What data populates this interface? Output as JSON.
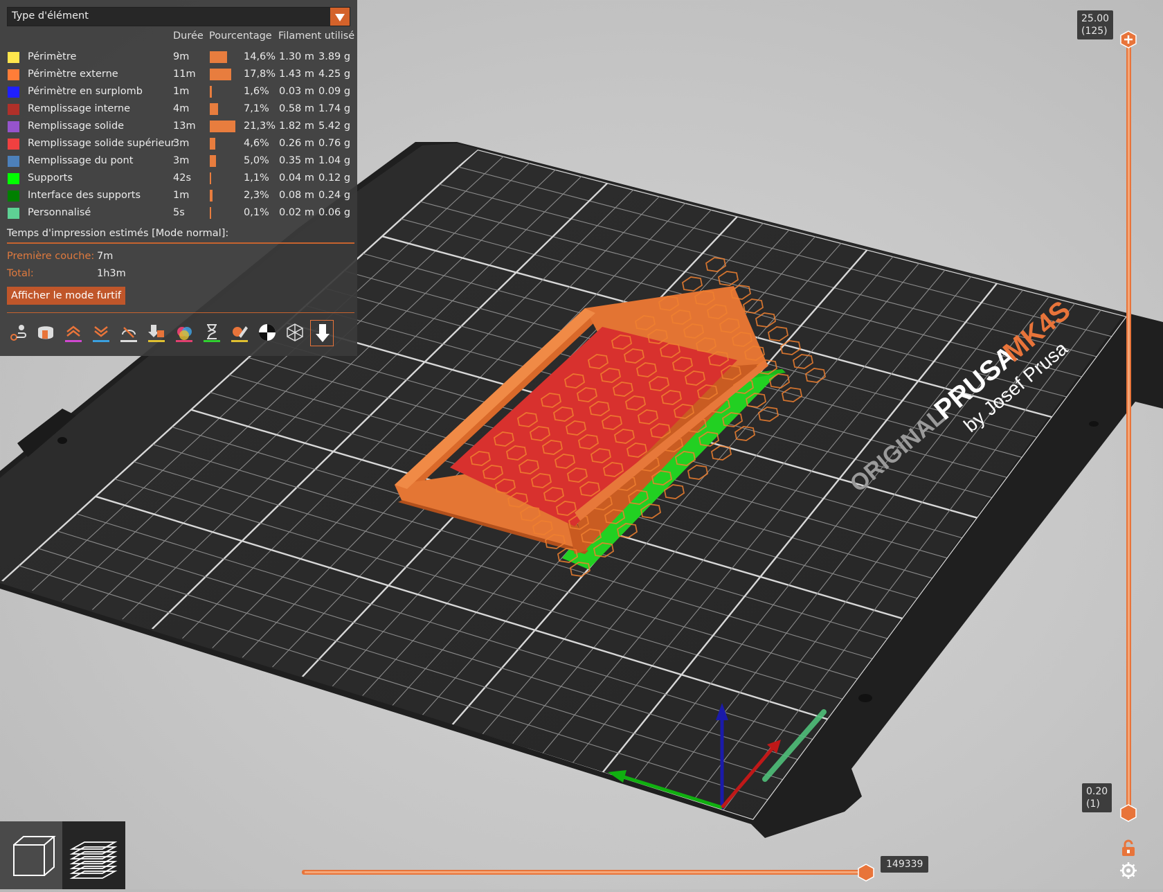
{
  "legend": {
    "dropdown_label": "Type d'élément",
    "columns": {
      "duration": "Durée",
      "percentage": "Pourcentage",
      "filament": "Filament utilisé"
    },
    "rows": [
      {
        "name": "Périmètre",
        "color": "#FFE64D",
        "time": "9m",
        "percent": "14,6%",
        "percent_value": 14.6,
        "length": "1.30 m",
        "weight": "3.89 g"
      },
      {
        "name": "Périmètre externe",
        "color": "#FF7D38",
        "time": "11m",
        "percent": "17,8%",
        "percent_value": 17.8,
        "length": "1.43 m",
        "weight": "4.25 g"
      },
      {
        "name": "Périmètre en surplomb",
        "color": "#1F1FFF",
        "time": "1m",
        "percent": "1,6%",
        "percent_value": 1.6,
        "length": "0.03 m",
        "weight": "0.09 g"
      },
      {
        "name": "Remplissage interne",
        "color": "#B03029",
        "time": "4m",
        "percent": "7,1%",
        "percent_value": 7.1,
        "length": "0.58 m",
        "weight": "1.74 g"
      },
      {
        "name": "Remplissage solide",
        "color": "#9654CC",
        "time": "13m",
        "percent": "21,3%",
        "percent_value": 21.3,
        "length": "1.82 m",
        "weight": "5.42 g"
      },
      {
        "name": "Remplissage solide supérieur",
        "color": "#F04040",
        "time": "3m",
        "percent": "4,6%",
        "percent_value": 4.6,
        "length": "0.26 m",
        "weight": "0.76 g"
      },
      {
        "name": "Remplissage du pont",
        "color": "#4D80BA",
        "time": "3m",
        "percent": "5,0%",
        "percent_value": 5.0,
        "length": "0.35 m",
        "weight": "1.04 g"
      },
      {
        "name": "Supports",
        "color": "#00FF00",
        "time": "42s",
        "percent": "1,1%",
        "percent_value": 1.1,
        "length": "0.04 m",
        "weight": "0.12 g"
      },
      {
        "name": "Interface des supports",
        "color": "#008000",
        "time": "1m",
        "percent": "2,3%",
        "percent_value": 2.3,
        "length": "0.08 m",
        "weight": "0.24 g"
      },
      {
        "name": "Personnalisé",
        "color": "#5ED194",
        "time": "5s",
        "percent": "0,1%",
        "percent_value": 0.1,
        "length": "0.02 m",
        "weight": "0.06 g"
      }
    ],
    "estimate_title": "Temps d'impression estimés [Mode normal]:",
    "first_layer_label": "Première couche:",
    "first_layer_value": "7m",
    "total_label": "Total:",
    "total_value": "1h3m",
    "stealth_button": "Afficher le mode furtif",
    "toolbar_icons": [
      "travel-icon",
      "wipe-icon",
      "retractions-icon",
      "deretractions-icon",
      "seams-icon",
      "tool-changes-icon",
      "color-changes-icon",
      "pause-icon",
      "custom-gcode-icon",
      "center-of-gravity-icon",
      "shells-icon",
      "tool-marker-icon"
    ]
  },
  "layer_slider": {
    "top_height": "25.00",
    "top_layer": "(125)",
    "bottom_height": "0.20",
    "bottom_layer": "(1)"
  },
  "move_slider": {
    "value": "149339"
  },
  "bed": {
    "brand_original": "ORIGINAL",
    "brand_prusa": "PRUSA",
    "brand_model": "MK4S",
    "brand_by": "by Josef Prusa"
  },
  "view_switch": {
    "active": "preview"
  },
  "colors": {
    "accent": "#E8743A",
    "panel": "#3A3A3A"
  }
}
